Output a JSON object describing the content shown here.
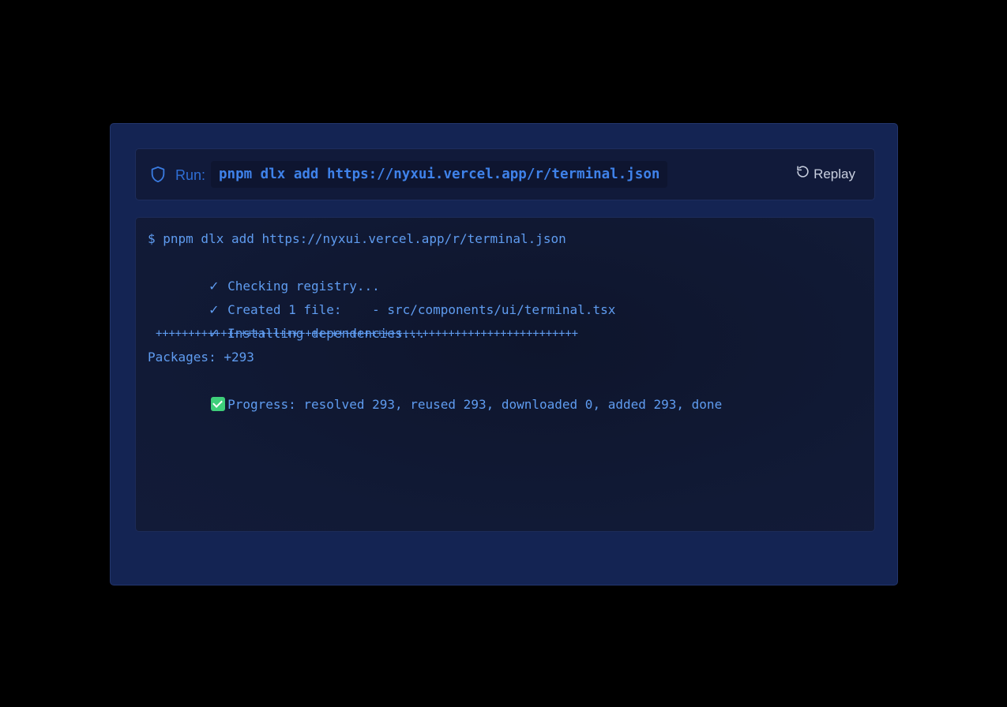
{
  "run_bar": {
    "label": "Run:",
    "command": "pnpm dlx add https://nyxui.vercel.app/r/terminal.json",
    "replay_label": "Replay"
  },
  "terminal": {
    "prompt_line": "$ pnpm dlx add https://nyxui.vercel.app/r/terminal.json",
    "check_mark": "✓",
    "steps": [
      "Checking registry...",
      "Created 1 file:    - src/components/ui/terminal.tsx",
      "Installing dependencies..."
    ],
    "progress_bar": "+++++++++++++++++++++++++++++++++++++++++++++++++++++++++++++++++",
    "packages_line": "Packages: +293",
    "progress_line": "Progress: resolved 293, reused 293, downloaded 0, added 293, done"
  },
  "colors": {
    "background": "#000000",
    "card": "#142453",
    "accent": "#3f82ea",
    "terminal_text": "#5f9cf0",
    "success": "#3ecf7a"
  }
}
